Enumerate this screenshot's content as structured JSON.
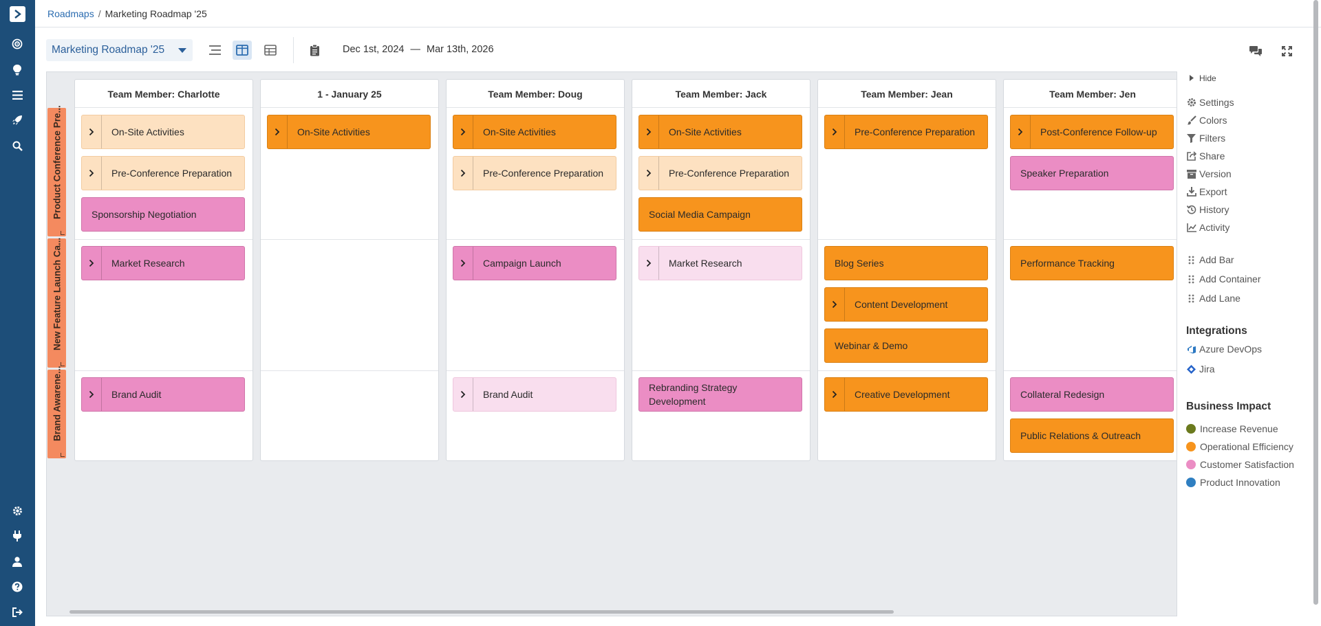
{
  "breadcrumb": {
    "root": "Roadmaps",
    "separator": "/",
    "current": "Marketing Roadmap '25"
  },
  "toolbar": {
    "roadmap_select": "Marketing Roadmap '25",
    "date_start": "Dec 1st, 2024",
    "date_sep": "—",
    "date_end": "Mar 13th, 2026"
  },
  "lanes": [
    {
      "label": "Product Conference Pre..."
    },
    {
      "label": "New Feature Launch Ca..."
    },
    {
      "label": "Brand Awarene..."
    }
  ],
  "columns": [
    {
      "header": "Team Member: Charlotte"
    },
    {
      "header": "1 - January 25"
    },
    {
      "header": "Team Member: Doug"
    },
    {
      "header": "Team Member: Jack"
    },
    {
      "header": "Team Member: Jean"
    },
    {
      "header": "Team Member: Jen"
    }
  ],
  "bars": {
    "charlotte": [
      "On-Site Activities",
      "Pre-Conference Preparation",
      "Sponsorship Negotiation",
      "Market Research",
      "Brand Audit"
    ],
    "january": [
      "On-Site Activities"
    ],
    "doug": [
      "On-Site Activities",
      "Pre-Conference Preparation",
      "Campaign Launch",
      "Brand Audit"
    ],
    "jack": [
      "On-Site Activities",
      "Pre-Conference Preparation",
      "Social Media Campaign",
      "Market Research",
      "Rebranding Strategy Development"
    ],
    "jean": [
      "Pre-Conference Preparation",
      "Blog Series",
      "Content Development",
      "Webinar & Demo",
      "Creative Development"
    ],
    "jen": [
      "Post-Conference Follow-up",
      "Speaker Preparation",
      "Performance Tracking",
      "Collateral Redesign",
      "Public Relations & Outreach"
    ]
  },
  "panel": {
    "hide": "Hide",
    "menu": [
      "Settings",
      "Colors",
      "Filters",
      "Share",
      "Version",
      "Export",
      "History",
      "Activity"
    ],
    "add": [
      "Add Bar",
      "Add Container",
      "Add Lane"
    ],
    "integrations_title": "Integrations",
    "integrations": [
      "Azure DevOps",
      "Jira"
    ],
    "impact_title": "Business Impact",
    "impact": [
      {
        "label": "Increase Revenue",
        "color": "#6b7a1e"
      },
      {
        "label": "Operational Efficiency",
        "color": "#f7941d"
      },
      {
        "label": "Customer Satisfaction",
        "color": "#eb8dc4"
      },
      {
        "label": "Product Innovation",
        "color": "#2f7fc1"
      }
    ]
  },
  "colors": {
    "nav": "#1d4e79",
    "orange": "#f7941d",
    "pink": "#eb8dc4",
    "light_orange": "#fde1c1",
    "light_pink": "#f9deee",
    "lane_tab": "#f48a5f"
  }
}
